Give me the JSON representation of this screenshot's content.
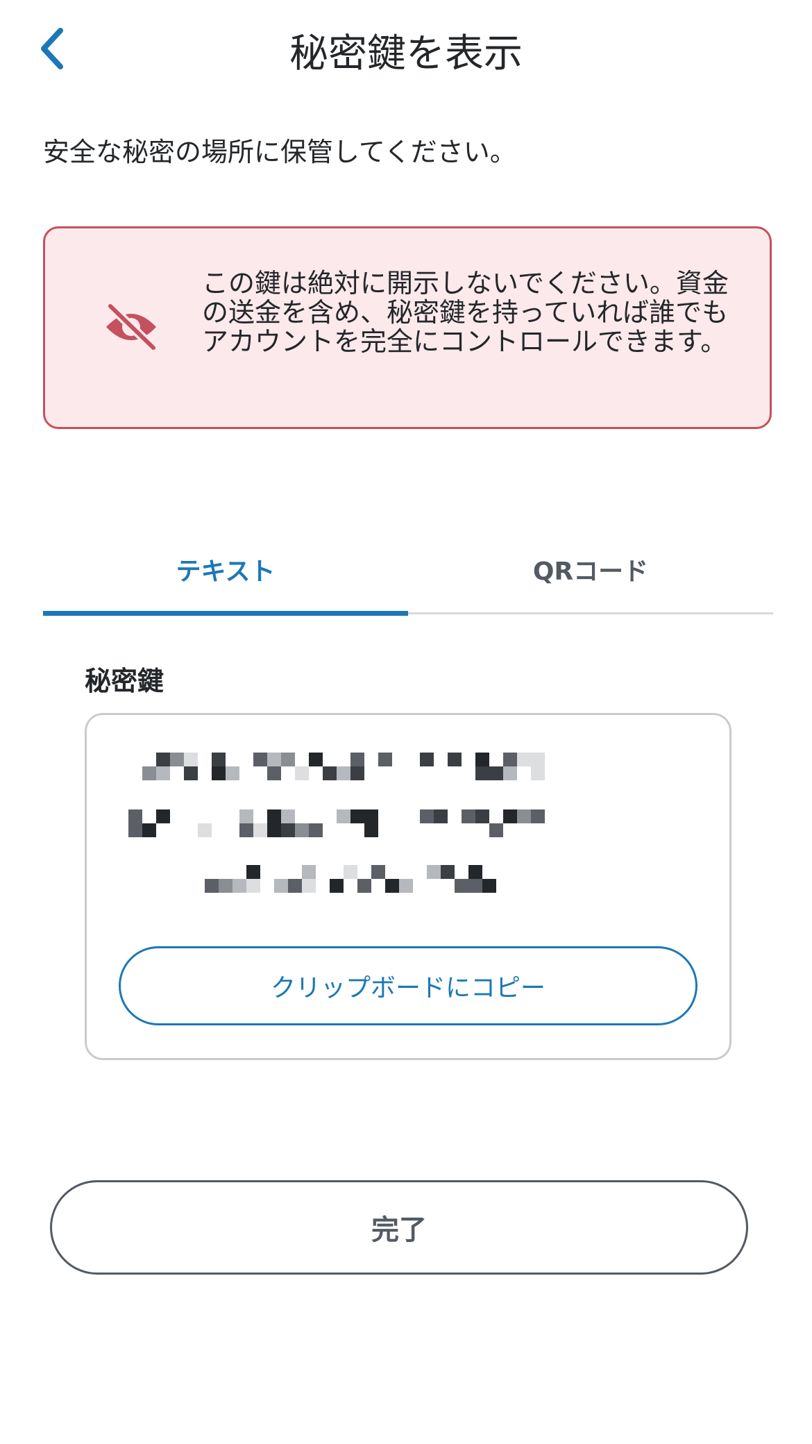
{
  "header": {
    "title": "秘密鍵を表示",
    "back_icon": "chevron-left-icon"
  },
  "subtitle": "安全な秘密の場所に保管してください。",
  "warning": {
    "icon": "eye-slash-icon",
    "text": "この鍵は絶対に開示しないでください。資金の送金を含め、秘密鍵を持っていれば誰でもアカウントを完全にコントロールできます。",
    "color": "#c4515e",
    "background": "#fce9ec"
  },
  "tabs": [
    {
      "label": "テキスト",
      "active": true
    },
    {
      "label": "QRコード",
      "active": false
    }
  ],
  "key": {
    "label": "秘密鍵",
    "value_redacted": true,
    "copy_label": "クリップボードにコピー"
  },
  "done_label": "完了",
  "colors": {
    "accent": "#1b78b8",
    "text": "#24272a",
    "muted": "#535a61"
  }
}
